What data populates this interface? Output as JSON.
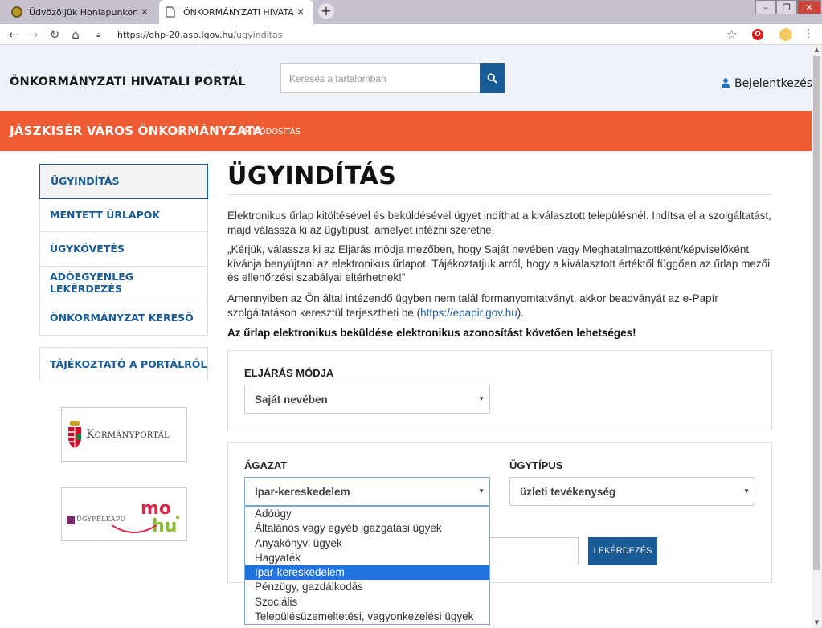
{
  "browser": {
    "tabs": [
      {
        "title": "Üdvözöljük Honlapunkon!",
        "active": false
      },
      {
        "title": "ÖNKORMÁNYZATI HIVATALI PORTÁL",
        "active": true
      }
    ],
    "url_host": "https://ohp-20.asp.lgov.hu",
    "url_path": "/ugyinditas"
  },
  "header": {
    "portal_title": "ÖNKORMÁNYZATI HIVATALI PORTÁL",
    "search_placeholder": "Keresés a tartalomban",
    "login_label": "Bejelentkezés"
  },
  "org_bar": {
    "name": "JÁSZKISÉR VÁROS ÖNKORMÁNYZATA",
    "modify_label": "MÓDOSÍTÁS",
    "color": "#ef5c34"
  },
  "sidebar": {
    "items": [
      {
        "label": "ÜGYINDÍTÁS",
        "active": true
      },
      {
        "label": "MENTETT ŰRLAPOK",
        "active": false
      },
      {
        "label": "ÜGYKÖVETÉS",
        "active": false
      },
      {
        "label": "ADÓEGYENLEG LEKÉRDEZÉS",
        "active": false
      },
      {
        "label": "ÖNKORMÁNYZAT KERESŐ",
        "active": false
      }
    ],
    "info_link": "TÁJÉKOZTATÓ A PORTÁLRÓL",
    "logos": {
      "kormanyportal": "Kormányportál",
      "ugyfelkapu": "ÜGYFÉLKAPU",
      "mohu": "mo hu"
    }
  },
  "main": {
    "title": "ÜGYINDÍTÁS",
    "paragraphs": {
      "p1": "Elektronikus űrlap kitöltésével és beküldésével ügyet indíthat a kiválasztott településnél. Indítsa el a szolgáltatást, majd válassza ki az ügytípust, amelyet intézni szeretne.",
      "p2": "„Kérjük, válassza ki az Eljárás módja mezőben, hogy Saját nevében vagy Meghatalmazottként/képviselőként kívánja benyújtani az elektronikus űrlapot. Tájékoztatjuk arról, hogy a kiválasztott értéktől függően az űrlap mezői és ellenőrzési szabályai eltérhetnek!”",
      "p3_before": "Amennyiben az Ön által intézendő ügyben nem talál formanyomtatványt, akkor beadványát az e-Papír szolgáltatáson keresztül terjesztheti be (",
      "p3_link": "https://epapir.gov.hu",
      "p3_after": ").",
      "p4": "Az űrlap elektronikus beküldése elektronikus azonosítást követően lehetséges!"
    },
    "eljaras": {
      "label": "ELJÁRÁS MÓDJA",
      "value": "Saját nevében"
    },
    "agazat": {
      "label": "ÁGAZAT",
      "value": "Ipar-kereskedelem",
      "options": [
        "Adóügy",
        "Általános vagy egyéb igazgatási ügyek",
        "Anyakönyvi ügyek",
        "Hagyaték",
        "Ipar-kereskedelem",
        "Pénzügy, gazdálkodás",
        "Szociális",
        "Településüzemeltetési, vagyonkezelési ügyek"
      ],
      "highlighted_index": 4
    },
    "ugytipus": {
      "label": "ÜGYTÍPUS",
      "value": "üzleti tevékenység"
    },
    "query_button": "LEKÉRDEZÉS"
  },
  "colors": {
    "primary_blue": "#195b96",
    "header_bg": "#eef3fb",
    "highlight": "#1e73e0"
  }
}
